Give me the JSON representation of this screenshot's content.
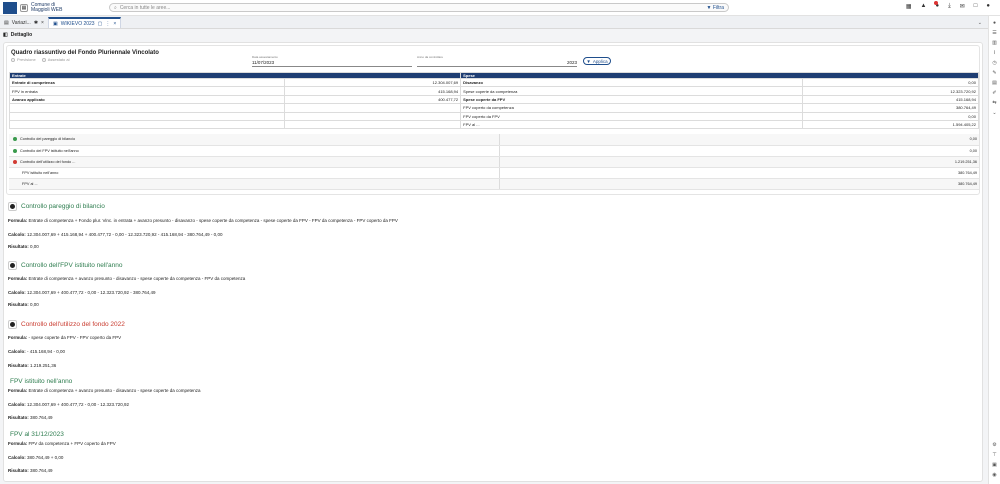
{
  "topbar": {
    "app_name": "Comune di Maggioli WEB",
    "search_placeholder": "Cerca in tutte le aree...",
    "filter_label": "Filtra"
  },
  "tabs": [
    {
      "label": "Variazi..."
    },
    {
      "label": "WIKIEVO 2023"
    }
  ],
  "subheader": {
    "title": "Dettaglio"
  },
  "summary": {
    "title": "Quadro riassuntivo del Fondo Pluriennale Vincolato",
    "radio1": "Previsione",
    "radio2": "Assestato al",
    "date_label": "Data assestamento",
    "date_value": "11/07/2023",
    "year_label": "Anno da controllare",
    "year_value": "2023",
    "apply_label": "Applica",
    "col_entrate": "Entrate",
    "col_spese": "Spese",
    "rows": [
      {
        "l": "Entrate di competenza",
        "lv": "12.304.007,69",
        "r": "Disavanzo",
        "rv": "0,00"
      },
      {
        "l": "FPV in entrata",
        "lv": "415.168,94",
        "r": "Spese coperte da competenza",
        "rv": "12.323.720,92"
      },
      {
        "l": "Avanzo applicato",
        "lv": "400.477,72",
        "r": "Spese coperte da FPV",
        "rv": "415.168,94"
      },
      {
        "l": "",
        "lv": "",
        "r": "FPV coperto da competenza",
        "rv": "380.764,49"
      },
      {
        "l": "",
        "lv": "",
        "r": "FPV coperto da FPV",
        "rv": "0,00"
      },
      {
        "l": "",
        "lv": "",
        "r": "FPV al ...",
        "rv": "1.594.405,22"
      }
    ],
    "checks": [
      {
        "label": "Controllo del pareggio di bilancio",
        "value": "0,00",
        "status": "green"
      },
      {
        "label": "Controllo del FPV istituito nell'anno",
        "value": "0,00",
        "status": "green"
      },
      {
        "label": "Controllo dell'utilizzo del fondo ...",
        "value": "1.219.251,36",
        "status": "red"
      },
      {
        "label": "FPV istituito nell'anno",
        "value": "380.764,49",
        "status": ""
      },
      {
        "label": "FPV al ...",
        "value": "380.764,49",
        "status": ""
      }
    ]
  },
  "sections": [
    {
      "title": "Controllo pareggio di bilancio",
      "formula_label": "Formula:",
      "formula": "Entrate di competenza + Fondo plur. Vinc. in entrata + avanzo presunto - disavanzo - spese coperte da competenza - spese coperte da FPV - FPV da competenza - FPV coperto da FPV",
      "calc_label": "Calcolo:",
      "calc": "12.304.007,69 + 415.168,94 + 400.477,72 - 0,00 - 12.323.720,92 - 415.168,94 - 380.764,49 - 0,00",
      "result_label": "Risultato:",
      "result": "0,00"
    },
    {
      "title": "Controllo dell'FPV istituito nell'anno",
      "formula_label": "Formula:",
      "formula": "Entrate di competenza + avanzo presunto - disavanzo - spese coperte da competenza - FPV da competenza",
      "calc_label": "Calcolo:",
      "calc": "12.304.007,69 + 400.477,72 - 0,00 - 12.323.720,92 - 380.764,49",
      "result_label": "Risultato:",
      "result": "0,00"
    },
    {
      "title": "Controllo dell'utilizzo del fondo 2022",
      "formula_label": "Formula:",
      "formula": "- spese coperte da FPV - FPV coperto da FPV",
      "calc_label": "Calcolo:",
      "calc": "- 415.168,94 - 0,00",
      "result_label": "Risultato:",
      "result": "1.219.251,36"
    },
    {
      "title": "FPV istituito nell'anno",
      "formula_label": "Formula:",
      "formula": "Entrate di competenza + avanzo presunto - disavanzo - spese coperte da competenza",
      "calc_label": "Calcolo:",
      "calc": "12.304.007,69 + 400.477,72 - 0,00 - 12.323.720,92",
      "result_label": "Risultato:",
      "result": "380.764,49"
    },
    {
      "title": "FPV al 31/12/2023",
      "formula_label": "Formula:",
      "formula": "FPV da competenza + FPV coperto da FPV",
      "calc_label": "Calcolo:",
      "calc": "380.764,49 + 0,00",
      "result_label": "Risultato:",
      "result": "380.764,49"
    }
  ]
}
